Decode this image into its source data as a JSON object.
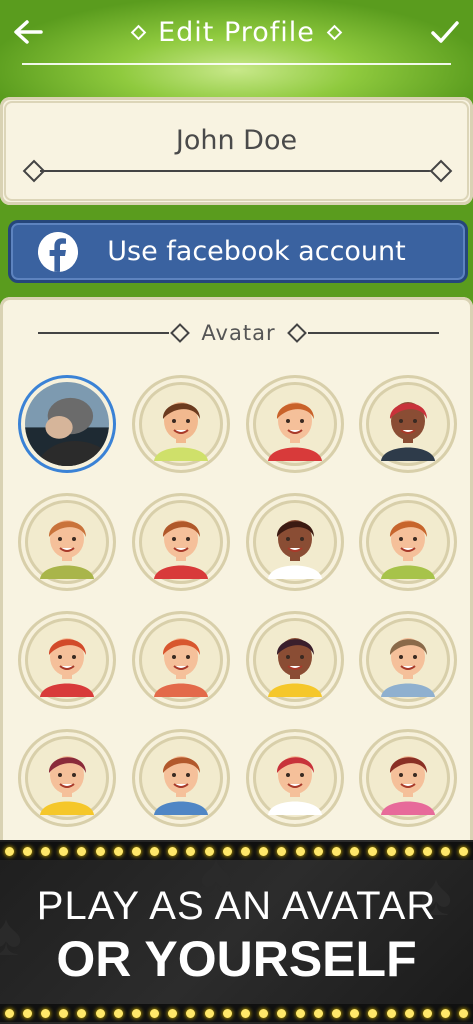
{
  "header": {
    "title": "Edit Profile",
    "back_icon": "arrow-left-icon",
    "confirm_icon": "checkmark-icon"
  },
  "profile": {
    "name": "John Doe"
  },
  "facebook": {
    "label": "Use facebook account",
    "icon": "facebook-icon"
  },
  "avatar_section": {
    "heading": "Avatar",
    "avatars": [
      {
        "id": "photo",
        "selected": true,
        "hair": "#6b6b6b",
        "skin": "#d6b59a",
        "shirt": "#2b2b2b"
      },
      {
        "id": "a2",
        "selected": false,
        "hair": "#6b3a1e",
        "skin": "#f2b98f",
        "shirt": "#cfe06a"
      },
      {
        "id": "a3",
        "selected": false,
        "hair": "#c9622a",
        "skin": "#f5c09a",
        "shirt": "#d83a3a"
      },
      {
        "id": "a4",
        "selected": false,
        "hair": "#c8323a",
        "skin": "#8a4d34",
        "shirt": "#2e3b4a"
      },
      {
        "id": "a5",
        "selected": false,
        "hair": "#c9733b",
        "skin": "#f5c09a",
        "shirt": "#a9b54a"
      },
      {
        "id": "a6",
        "selected": false,
        "hair": "#b0582a",
        "skin": "#f5c09a",
        "shirt": "#d83a3a"
      },
      {
        "id": "a7",
        "selected": false,
        "hair": "#3b1a12",
        "skin": "#8a4d34",
        "shirt": "#ffffff"
      },
      {
        "id": "a8",
        "selected": false,
        "hair": "#c7652c",
        "skin": "#f5c09a",
        "shirt": "#a7c34a"
      },
      {
        "id": "a9",
        "selected": false,
        "hair": "#d24a2a",
        "skin": "#f5c09a",
        "shirt": "#d83a3a"
      },
      {
        "id": "a10",
        "selected": false,
        "hair": "#d8562e",
        "skin": "#f5c09a",
        "shirt": "#e36a4a"
      },
      {
        "id": "a11",
        "selected": false,
        "hair": "#3a1f2c",
        "skin": "#8a4d34",
        "shirt": "#f5c72a"
      },
      {
        "id": "a12",
        "selected": false,
        "hair": "#8a6a4a",
        "skin": "#f5c09a",
        "shirt": "#8fb0cf"
      },
      {
        "id": "a13",
        "selected": false,
        "hair": "#8a2a3a",
        "skin": "#f5c09a",
        "shirt": "#f5c72a"
      },
      {
        "id": "a14",
        "selected": false,
        "hair": "#b2582c",
        "skin": "#f5c09a",
        "shirt": "#4f86c5"
      },
      {
        "id": "a15",
        "selected": false,
        "hair": "#c8323a",
        "skin": "#f5c09a",
        "shirt": "#ffffff"
      },
      {
        "id": "a16",
        "selected": false,
        "hair": "#8a2f24",
        "skin": "#f5c09a",
        "shirt": "#e76a9a"
      }
    ]
  },
  "banner": {
    "line1": "PLAY AS AN AVATAR",
    "line2": "OR YOURSELF"
  },
  "colors": {
    "header_green": "#5a9c1e",
    "facebook_blue": "#3a62a0",
    "panel_cream": "#f8f3e1",
    "selected_ring": "#3a82d6"
  }
}
